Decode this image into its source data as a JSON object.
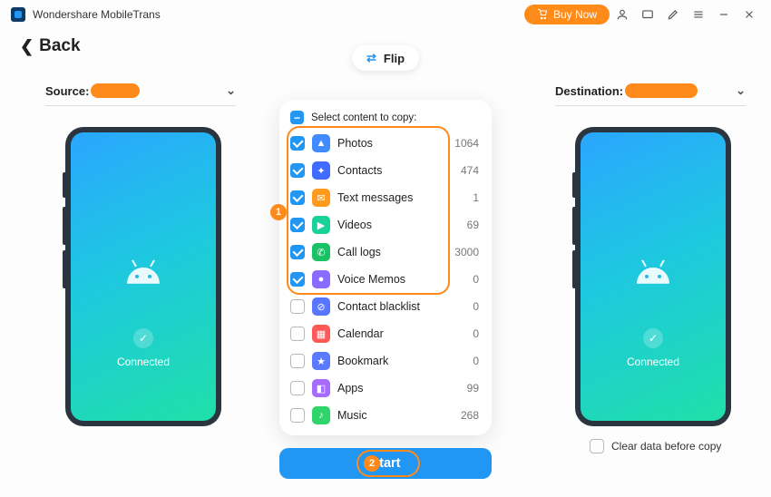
{
  "app": {
    "title": "Wondershare MobileTrans",
    "buy_now": "Buy Now",
    "back_label": "Back",
    "flip_label": "Flip"
  },
  "source": {
    "label": "Source:",
    "status": "Connected"
  },
  "destination": {
    "label": "Destination:",
    "status": "Connected"
  },
  "panel": {
    "header": "Select content to copy:"
  },
  "startbtn": {
    "label": "Start"
  },
  "clear": {
    "label": "Clear data before copy"
  },
  "items": [
    {
      "label": "Photos",
      "count": 1064,
      "checked": true,
      "color": "#3f8bff",
      "glyph": "▲"
    },
    {
      "label": "Contacts",
      "count": 474,
      "checked": true,
      "color": "#3f6cff",
      "glyph": "✦"
    },
    {
      "label": "Text messages",
      "count": 1,
      "checked": true,
      "color": "#ff9a1f",
      "glyph": "✉"
    },
    {
      "label": "Videos",
      "count": 69,
      "checked": true,
      "color": "#1ad19a",
      "glyph": "▶"
    },
    {
      "label": "Call logs",
      "count": 3000,
      "checked": true,
      "color": "#19c264",
      "glyph": "✆"
    },
    {
      "label": "Voice Memos",
      "count": 0,
      "checked": true,
      "color": "#8a6bff",
      "glyph": "●"
    },
    {
      "label": "Contact blacklist",
      "count": 0,
      "checked": false,
      "color": "#5876ff",
      "glyph": "⊘"
    },
    {
      "label": "Calendar",
      "count": 0,
      "checked": false,
      "color": "#ff5a5a",
      "glyph": "▦"
    },
    {
      "label": "Bookmark",
      "count": 0,
      "checked": false,
      "color": "#5a7bff",
      "glyph": "★"
    },
    {
      "label": "Apps",
      "count": 99,
      "checked": false,
      "color": "#a66bff",
      "glyph": "◧"
    },
    {
      "label": "Music",
      "count": 268,
      "checked": false,
      "color": "#2fd46a",
      "glyph": "♪"
    }
  ]
}
